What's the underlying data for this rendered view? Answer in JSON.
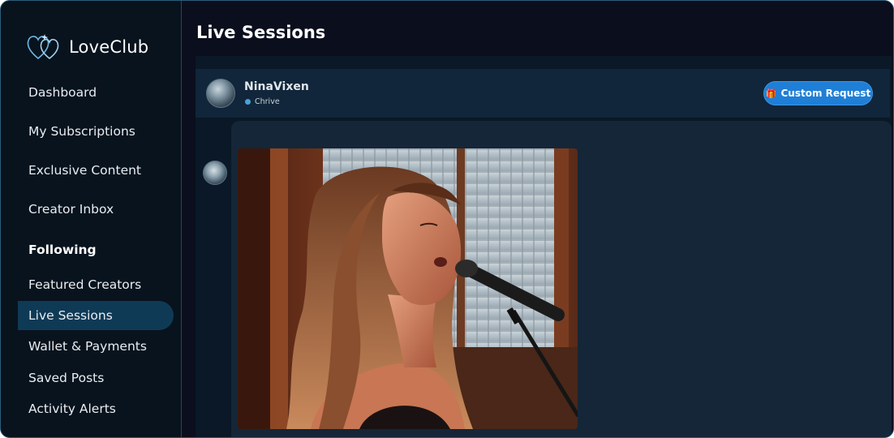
{
  "app": {
    "name": "LoveClub"
  },
  "sidebar": {
    "items": [
      {
        "label": "Dashboard"
      },
      {
        "label": "My Subscriptions"
      },
      {
        "label": "Exclusive Content"
      },
      {
        "label": "Creator Inbox"
      }
    ],
    "section_heading": "Following",
    "following_items": [
      {
        "label": "Featured Creators"
      },
      {
        "label": "Live Sessions",
        "active": true
      },
      {
        "label": "Wallet & Payments"
      },
      {
        "label": "Saved Posts"
      },
      {
        "label": "Activity Alerts"
      }
    ]
  },
  "page": {
    "title": "Live Sessions"
  },
  "chat": {
    "creator_name": "NinaVixen",
    "status": "Chrive",
    "request_button": "Custom Request",
    "request_icon": "gift-icon"
  },
  "message": {
    "image_alt": "woman-singing-into-microphone-photo"
  },
  "colors": {
    "accent": "#1f7fd6",
    "sidebar_active": "#0f3a56",
    "sidebar_bg": "#08131d",
    "main_bg": "#0b0e1d",
    "status": "#4aa3d8"
  }
}
